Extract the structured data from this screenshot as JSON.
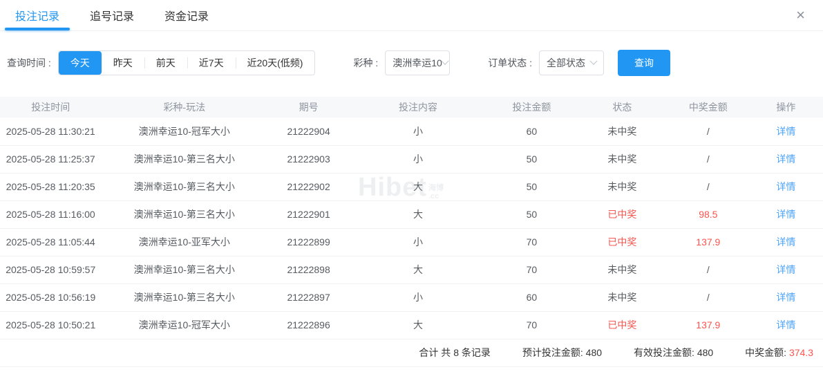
{
  "accent": "#2196f3",
  "danger": "#f8544e",
  "tabs": [
    {
      "label": "投注记录",
      "active": true
    },
    {
      "label": "追号记录",
      "active": false
    },
    {
      "label": "资金记录",
      "active": false
    }
  ],
  "close_glyph": "×",
  "filters": {
    "time_label": "查询时间 :",
    "time_options": [
      {
        "label": "今天",
        "active": true
      },
      {
        "label": "昨天",
        "active": false
      },
      {
        "label": "前天",
        "active": false
      },
      {
        "label": "近7天",
        "active": false
      },
      {
        "label": "近20天(低频)",
        "active": false
      }
    ],
    "lottery_label": "彩种 :",
    "lottery_value": "澳洲幸运10",
    "status_label": "订单状态 :",
    "status_value": "全部状态",
    "search_label": "查询"
  },
  "table": {
    "columns": [
      "投注时间",
      "彩种-玩法",
      "期号",
      "投注内容",
      "投注金额",
      "状态",
      "中奖金额",
      "操作"
    ],
    "rows": [
      {
        "time": "2025-05-28 11:30:21",
        "game": "澳洲幸运10-冠军大小",
        "issue": "21222904",
        "content": "小",
        "amount": "60",
        "status": "未中奖",
        "won": false,
        "prize": "/",
        "action": "详情"
      },
      {
        "time": "2025-05-28 11:25:37",
        "game": "澳洲幸运10-第三名大小",
        "issue": "21222903",
        "content": "小",
        "amount": "50",
        "status": "未中奖",
        "won": false,
        "prize": "/",
        "action": "详情"
      },
      {
        "time": "2025-05-28 11:20:35",
        "game": "澳洲幸运10-第三名大小",
        "issue": "21222902",
        "content": "大",
        "amount": "50",
        "status": "未中奖",
        "won": false,
        "prize": "/",
        "action": "详情"
      },
      {
        "time": "2025-05-28 11:16:00",
        "game": "澳洲幸运10-第三名大小",
        "issue": "21222901",
        "content": "大",
        "amount": "50",
        "status": "已中奖",
        "won": true,
        "prize": "98.5",
        "action": "详情"
      },
      {
        "time": "2025-05-28 11:05:44",
        "game": "澳洲幸运10-亚军大小",
        "issue": "21222899",
        "content": "小",
        "amount": "70",
        "status": "已中奖",
        "won": true,
        "prize": "137.9",
        "action": "详情"
      },
      {
        "time": "2025-05-28 10:59:57",
        "game": "澳洲幸运10-第三名大小",
        "issue": "21222898",
        "content": "大",
        "amount": "70",
        "status": "未中奖",
        "won": false,
        "prize": "/",
        "action": "详情"
      },
      {
        "time": "2025-05-28 10:56:19",
        "game": "澳洲幸运10-第三名大小",
        "issue": "21222897",
        "content": "小",
        "amount": "60",
        "status": "未中奖",
        "won": false,
        "prize": "/",
        "action": "详情"
      },
      {
        "time": "2025-05-28 10:50:21",
        "game": "澳洲幸运10-冠军大小",
        "issue": "21222896",
        "content": "大",
        "amount": "70",
        "status": "已中奖",
        "won": true,
        "prize": "137.9",
        "action": "详情"
      }
    ]
  },
  "summary": {
    "total_text": "合计 共 8 条记录",
    "expected_label": "预计投注金额:",
    "expected_value": "480",
    "valid_label": "有效投注金额:",
    "valid_value": "480",
    "prize_label": "中奖金额:",
    "prize_value": "374.3"
  },
  "watermark": {
    "main": "Hibet",
    "sub_top": "海博",
    "sub_bottom": ".cc"
  }
}
